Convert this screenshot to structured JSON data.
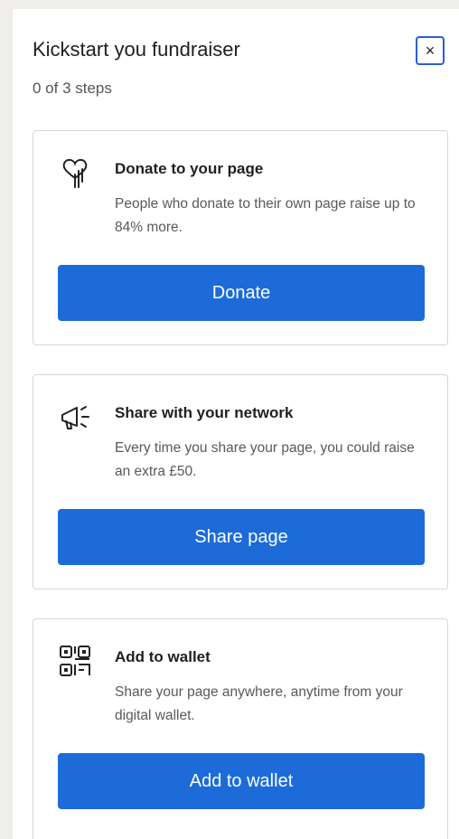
{
  "header": {
    "title": "Kickstart you fundraiser",
    "progress": "0 of 3 steps",
    "close_label": "×"
  },
  "steps": [
    {
      "icon": "heart-hand-icon",
      "title": "Donate to your page",
      "description": "People who donate to their own page raise up to 84% more.",
      "button": "Donate"
    },
    {
      "icon": "megaphone-icon",
      "title": "Share with your network",
      "description": "Every time you share your page, you could raise an extra £50.",
      "button": "Share page"
    },
    {
      "icon": "qr-code-icon",
      "title": "Add to wallet",
      "description": "Share your page anywhere, anytime from your digital wallet.",
      "button": "Add to wallet"
    }
  ],
  "colors": {
    "primary": "#1c6bd9",
    "close_border": "#2a5fd0"
  }
}
